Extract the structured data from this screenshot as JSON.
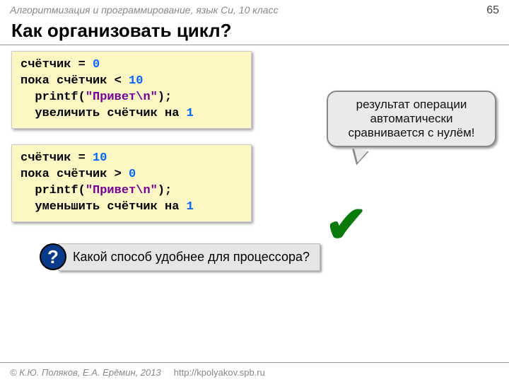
{
  "header": {
    "course": "Алгоритмизация и программирование, язык Си, 10 класс",
    "page_number": "65"
  },
  "title": "Как организовать цикл?",
  "code1": {
    "l1a": "счётчик = ",
    "l1b": "0",
    "l2a": "пока счётчик < ",
    "l2b": "10",
    "l3a": "  printf(",
    "l3b": "\"Привет\\n\"",
    "l3c": ");",
    "l4a": "  увеличить счётчик на ",
    "l4b": "1"
  },
  "callout": {
    "text": "результат операции автоматически сравнивается с нулём!"
  },
  "code2": {
    "l1a": "счётчик = ",
    "l1b": "10",
    "l2a": "пока счётчик > ",
    "l2b": "0",
    "l3a": "  printf(",
    "l3b": "\"Привет\\n\"",
    "l3c": ");",
    "l4a": "  уменьшить счётчик на ",
    "l4b": "1"
  },
  "checkmark": "✔",
  "question": {
    "icon": "?",
    "text": "Какой способ удобнее для процессора?"
  },
  "footer": {
    "authors": "© К.Ю. Поляков, Е.А. Ерёмин, 2013",
    "url": "http://kpolyakov.spb.ru"
  }
}
